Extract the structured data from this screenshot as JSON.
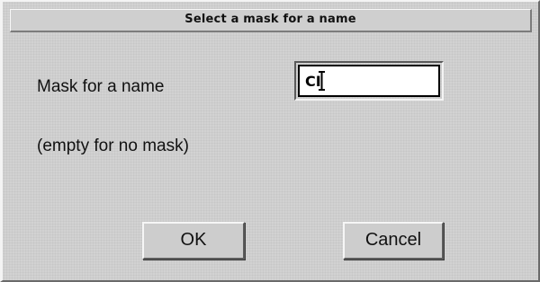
{
  "dialog": {
    "title": "Select a mask for a name",
    "mask_label": "Mask for a name",
    "hint_label": "(empty for no mask)",
    "mask_input": {
      "value": "CI"
    },
    "buttons": {
      "ok": "OK",
      "cancel": "Cancel"
    },
    "icons": {
      "cursor": "ibeam-icon"
    }
  }
}
